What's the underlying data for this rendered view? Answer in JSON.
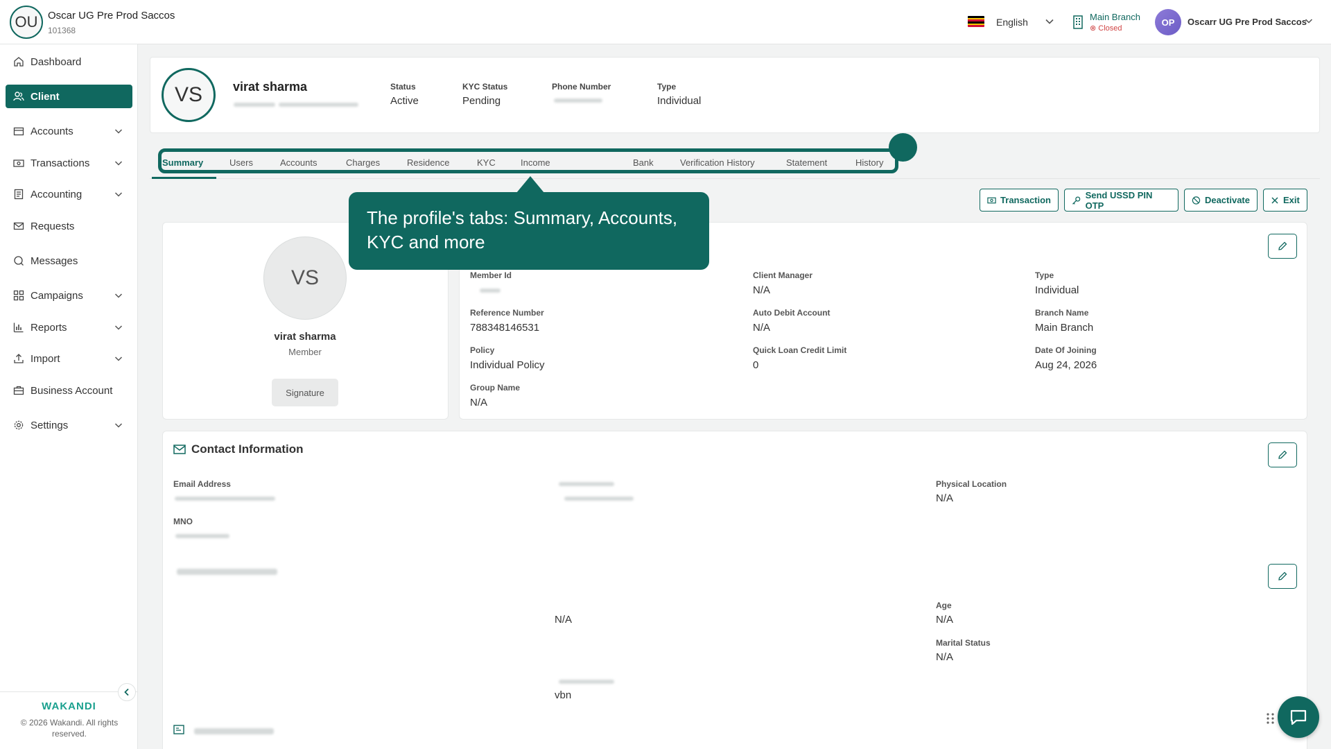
{
  "org": {
    "initials": "OU",
    "name": "Oscar UG Pre Prod Saccos",
    "code": "101368"
  },
  "topbar": {
    "language": "English",
    "branch_name": "Main Branch",
    "branch_status": "Closed",
    "user_initials": "OP",
    "user_name": "Oscarr UG Pre Prod Saccos"
  },
  "sidebar": {
    "items": [
      {
        "label": "Dashboard",
        "icon": "home-icon",
        "chevron": false
      },
      {
        "label": "Client",
        "icon": "users-icon",
        "chevron": false,
        "active": true
      },
      {
        "label": "Accounts",
        "icon": "wallet-icon",
        "chevron": true
      },
      {
        "label": "Transactions",
        "icon": "cash-icon",
        "chevron": true
      },
      {
        "label": "Accounting",
        "icon": "ledger-icon",
        "chevron": true
      },
      {
        "label": "Requests",
        "icon": "mail-icon",
        "chevron": false
      },
      {
        "label": "Messages",
        "icon": "chat-icon",
        "chevron": false
      },
      {
        "label": "Campaigns",
        "icon": "grid-icon",
        "chevron": true
      },
      {
        "label": "Reports",
        "icon": "bar-chart-icon",
        "chevron": true
      },
      {
        "label": "Import",
        "icon": "upload-icon",
        "chevron": true
      },
      {
        "label": "Business Account",
        "icon": "briefcase-icon",
        "chevron": false
      },
      {
        "label": "Settings",
        "icon": "gear-icon",
        "chevron": true
      }
    ],
    "brand": "WAKANDI",
    "copyright": "© 2026 Wakandi. All rights reserved."
  },
  "profile": {
    "initials": "VS",
    "name": "virat sharma",
    "fields": [
      {
        "label": "Status",
        "value": "Active"
      },
      {
        "label": "KYC Status",
        "value": "Pending"
      },
      {
        "label": "Phone Number",
        "value": ""
      },
      {
        "label": "Type",
        "value": "Individual"
      }
    ]
  },
  "tabs": [
    "Summary",
    "Users",
    "Accounts",
    "Charges",
    "Residence",
    "KYC",
    "Income",
    "Bank",
    "Verification History",
    "Statement",
    "History"
  ],
  "actions": {
    "transaction": "Transaction",
    "send_otp": "Send USSD PIN OTP",
    "deactivate": "Deactivate",
    "exit": "Exit"
  },
  "member_card": {
    "initials": "VS",
    "name": "virat sharma",
    "role": "Member",
    "signature": "Signature"
  },
  "details": {
    "member_id_label": "Member Id",
    "member_id_value": "",
    "client_manager_label": "Client Manager",
    "client_manager_value": "N/A",
    "type_label": "Type",
    "type_value": "Individual",
    "reference_label": "Reference Number",
    "reference_value": "788348146531",
    "auto_debit_label": "Auto Debit Account",
    "auto_debit_value": "N/A",
    "branch_label": "Branch Name",
    "branch_value": "Main Branch",
    "policy_label": "Policy",
    "policy_value": "Individual Policy",
    "quick_loan_label": "Quick Loan Credit Limit",
    "quick_loan_value": "0",
    "joining_label": "Date Of Joining",
    "joining_value": "Aug 24, 2026",
    "group_label": "Group Name",
    "group_value": "N/A"
  },
  "contact": {
    "title": "Contact Information",
    "email_label": "Email Address",
    "physical_label": "Physical Location",
    "physical_value": "N/A",
    "mno_label": "MNO"
  },
  "personal": {
    "mid_value": "N/A",
    "age_label": "Age",
    "age_value": "N/A",
    "marital_label": "Marital Status",
    "marital_value": "N/A",
    "bottom_value": "vbn"
  },
  "tooltip": {
    "text": "The profile's tabs: Summary, Accounts, KYC and more"
  },
  "colors": {
    "accent": "#10685f",
    "closed": "#d04545"
  }
}
